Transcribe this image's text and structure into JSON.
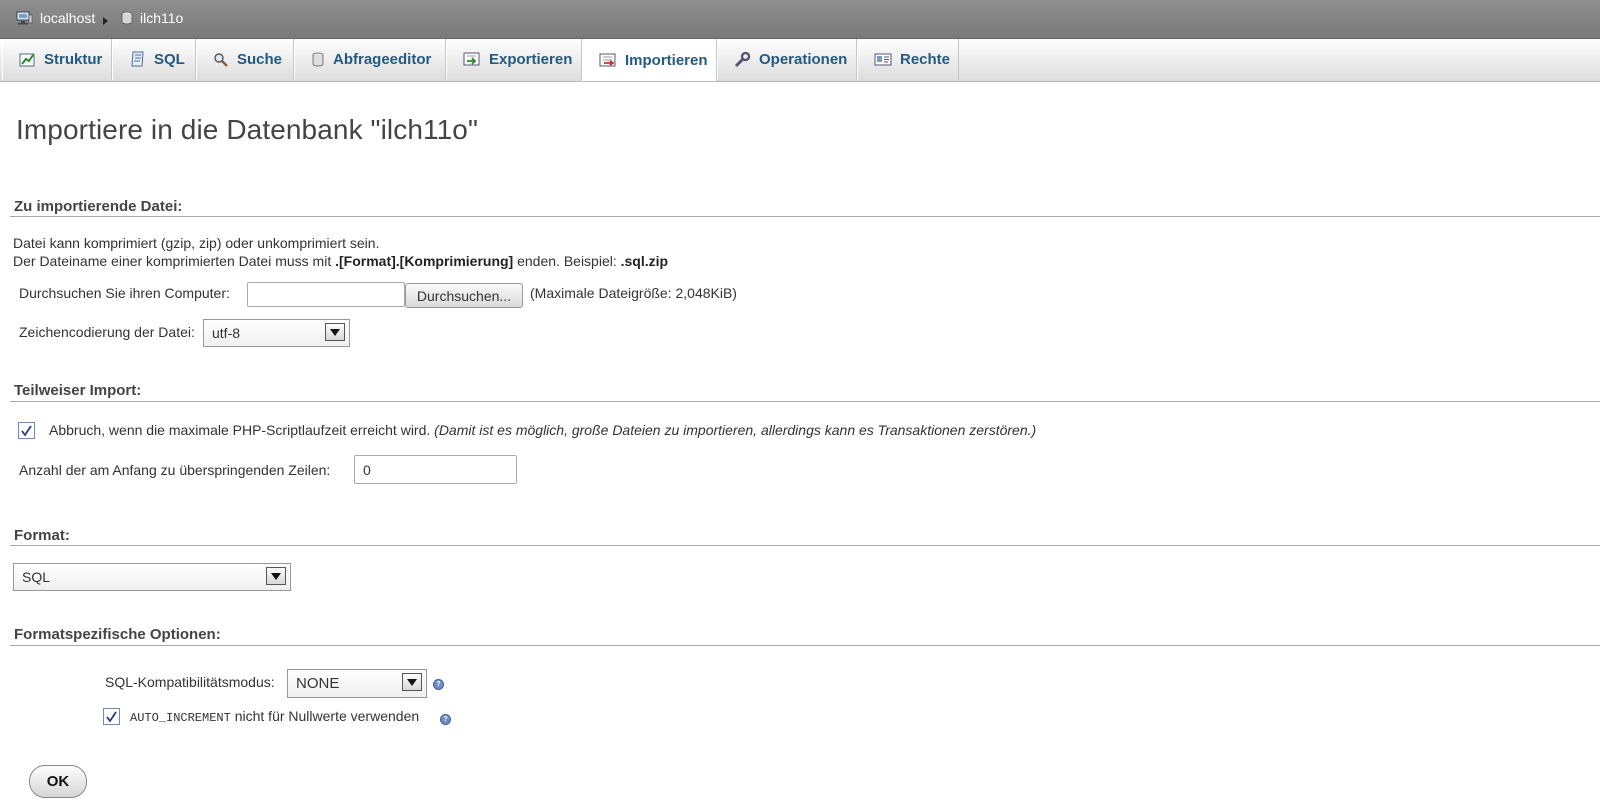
{
  "breadcrumb": {
    "server": "localhost",
    "database": "ilch11o"
  },
  "tabs": [
    {
      "label": "Struktur",
      "icon": "structure-icon"
    },
    {
      "label": "SQL",
      "icon": "sql-icon"
    },
    {
      "label": "Suche",
      "icon": "search-icon"
    },
    {
      "label": "Abfrageeditor",
      "icon": "query-icon"
    },
    {
      "label": "Exportieren",
      "icon": "export-icon"
    },
    {
      "label": "Importieren",
      "icon": "import-icon",
      "active": true
    },
    {
      "label": "Operationen",
      "icon": "wrench-icon"
    },
    {
      "label": "Rechte",
      "icon": "privileges-icon"
    }
  ],
  "page_title": "Importiere in die Datenbank \"ilch11o\"",
  "file_section": {
    "heading": "Zu importierende Datei:",
    "line1": "Datei kann komprimiert (gzip, zip) oder unkomprimiert sein.",
    "line2_prefix": "Der Dateiname einer komprimierten Datei muss mit ",
    "line2_bold": ".[Format].[Komprimierung]",
    "line2_mid": " enden. Beispiel: ",
    "line2_example": ".sql.zip",
    "browse_label": "Durchsuchen Sie ihren Computer:",
    "browse_button": "Durchsuchen...",
    "max_size": "(Maximale Dateigröße: 2,048KiB)",
    "charset_label": "Zeichencodierung der Datei:",
    "charset_value": "utf-8"
  },
  "partial_section": {
    "heading": "Teilweiser Import:",
    "abort_label": "Abbruch, wenn die maximale PHP-Scriptlaufzeit erreicht wird.",
    "abort_note": "(Damit ist es möglich, große Dateien zu importieren, allerdings kann es Transaktionen zerstören.)",
    "abort_checked": true,
    "skip_label": "Anzahl der am Anfang zu überspringenden Zeilen:",
    "skip_value": "0"
  },
  "format_section": {
    "heading": "Format:",
    "value": "SQL"
  },
  "options_section": {
    "heading": "Formatspezifische Optionen:",
    "compat_label": "SQL-Kompatibilitätsmodus:",
    "compat_value": "NONE",
    "autoinc_code": "AUTO_INCREMENT",
    "autoinc_label": " nicht für Nullwerte verwenden",
    "autoinc_checked": true
  },
  "submit_label": "OK",
  "colors": {
    "link": "#235a81",
    "topbar": "#888888"
  }
}
